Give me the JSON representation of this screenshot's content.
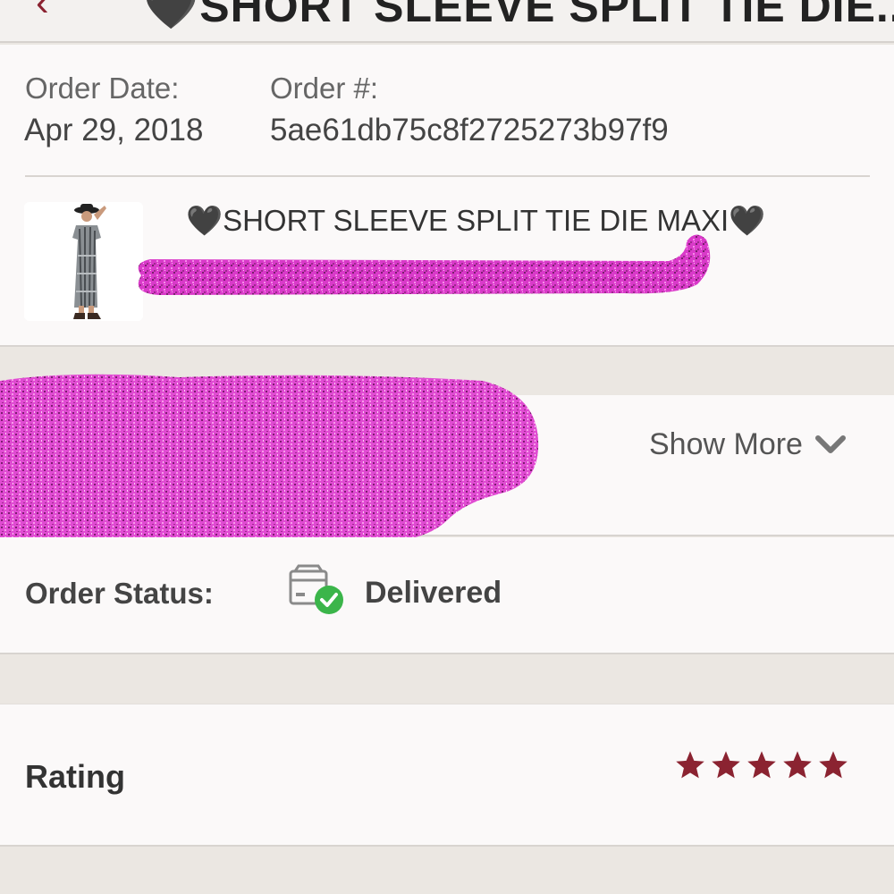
{
  "header": {
    "title": "🖤SHORT SLEEVE SPLIT TIE DIE...",
    "back_icon": "chevron-left-icon"
  },
  "order": {
    "date_label": "Order Date:",
    "date_value": "Apr 29, 2018",
    "number_label": "Order #:",
    "number_value": "5ae61db75c8f2725273b97f9"
  },
  "product": {
    "name_prefix": "🖤",
    "name": "SHORT SLEEVE SPLIT TIE DIE MAXI",
    "name_suffix": "🖤",
    "image_icon": "product-photo-icon"
  },
  "details": {
    "show_more_label": "Show More",
    "show_more_icon": "chevron-down-icon"
  },
  "status": {
    "label": "Order Status:",
    "value": "Delivered",
    "icon": "package-check-icon"
  },
  "rating": {
    "label": "Rating",
    "stars": 5,
    "max_stars": 5
  },
  "colors": {
    "accent": "#8b2331",
    "success": "#3bb54a",
    "redaction": "#e23fd3"
  }
}
